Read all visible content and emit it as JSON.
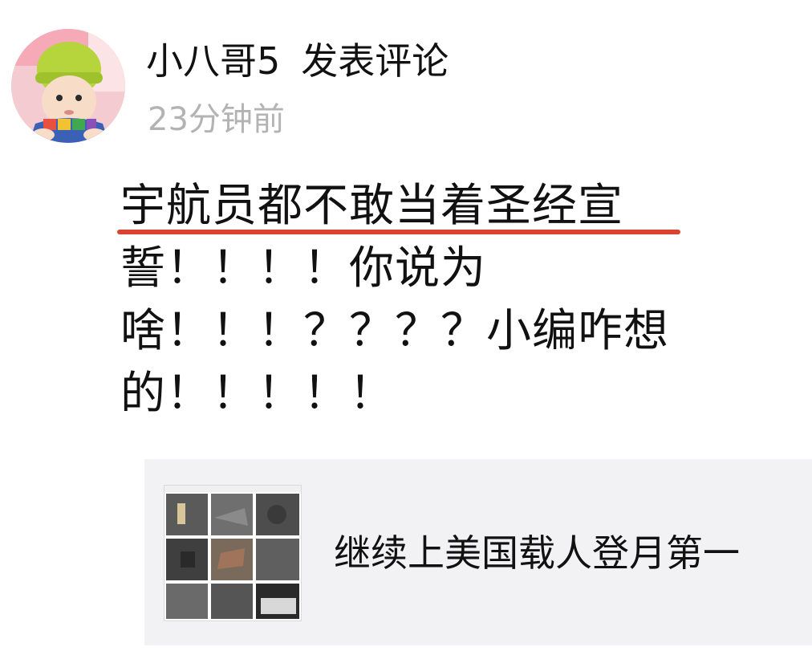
{
  "post": {
    "author_name": "小八哥5",
    "action": "发表评论",
    "timestamp": "23分钟前",
    "comment_lines": [
      "宇航员都不敢当着圣经宣",
      "誓！！！！你说为",
      "啥！！！？？？？小编咋想",
      "的！！！！！"
    ],
    "highlight_color": "#d9432f"
  },
  "shared_article": {
    "title": "继续上美国载人登月第一"
  },
  "icons": {
    "avatar": "baby-avatar-photo",
    "thumbnail": "moon-landing-photo-grid"
  }
}
